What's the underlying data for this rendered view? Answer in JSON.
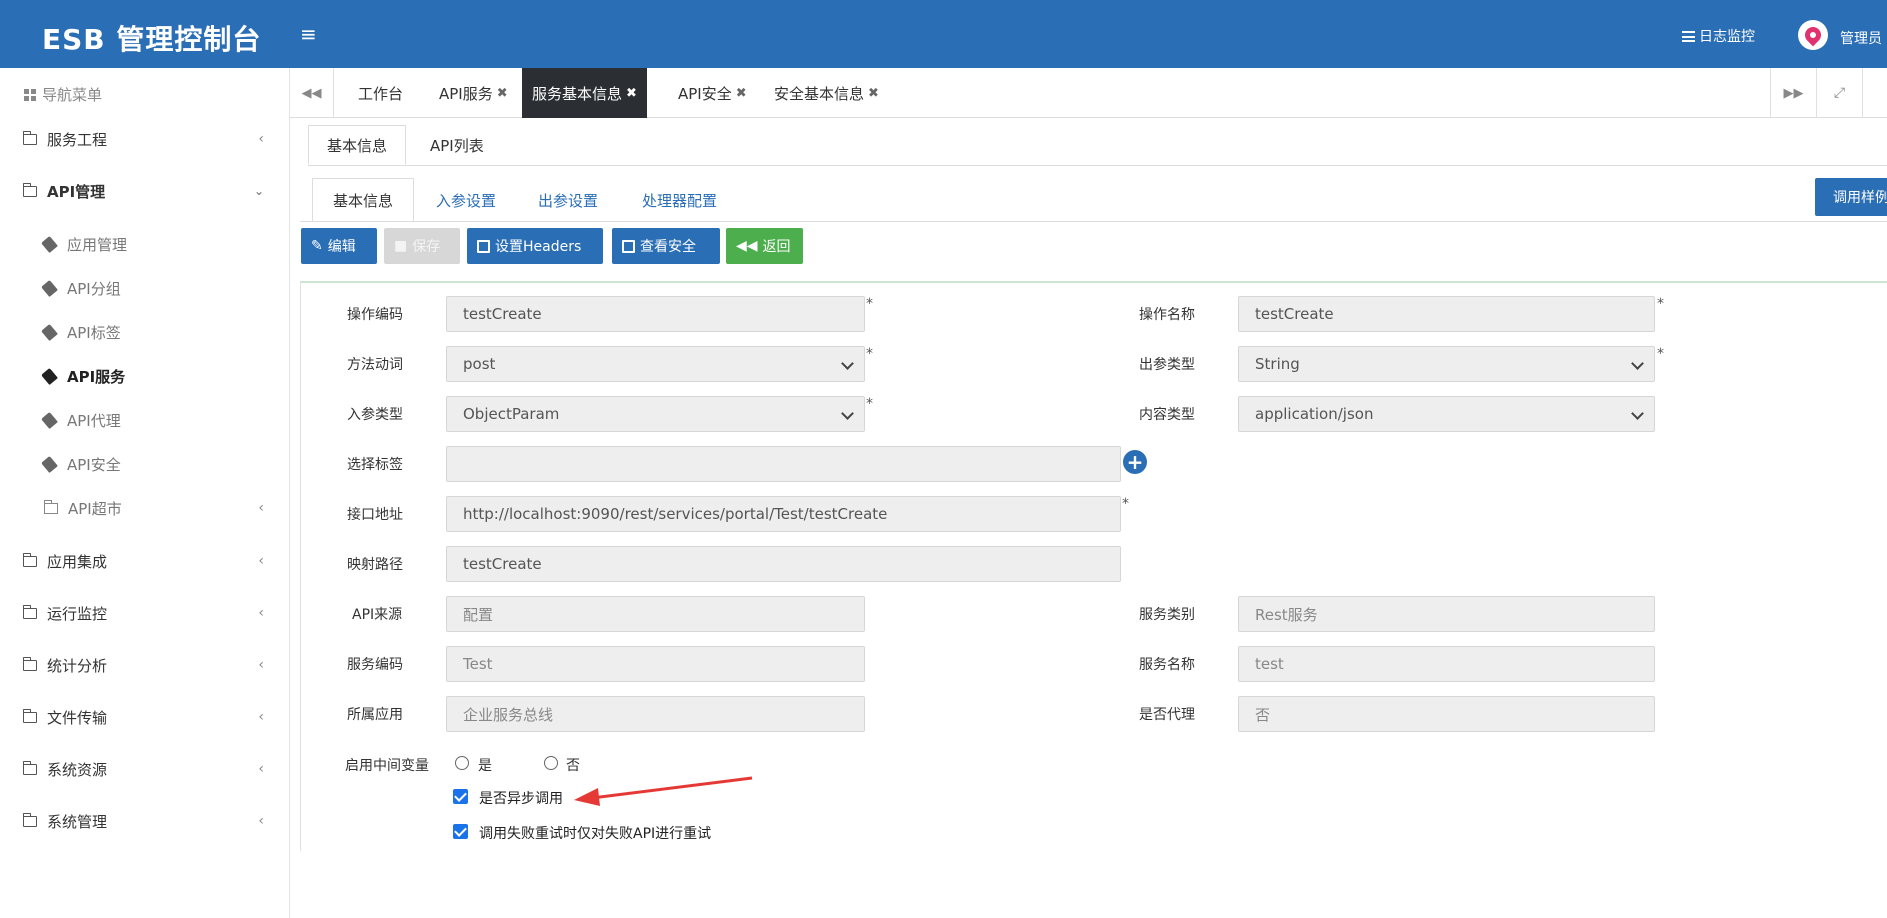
{
  "header": {
    "brand": "ESB 管理控制台",
    "menu_icon": "hamburger-icon",
    "log_monitor": "日志监控",
    "user": "管理员"
  },
  "sidebar": {
    "title": "导航菜单",
    "items": [
      {
        "label": "服务工程"
      },
      {
        "label": "API管理"
      },
      {
        "label": "应用集成"
      },
      {
        "label": "运行监控"
      },
      {
        "label": "统计分析"
      },
      {
        "label": "文件传输"
      },
      {
        "label": "系统资源"
      },
      {
        "label": "系统管理"
      }
    ],
    "api_sub": [
      {
        "label": "应用管理"
      },
      {
        "label": "API分组"
      },
      {
        "label": "API标签"
      },
      {
        "label": "API服务"
      },
      {
        "label": "API代理"
      },
      {
        "label": "API安全"
      },
      {
        "label": "API超市"
      }
    ]
  },
  "tabs": [
    {
      "label": "工作台"
    },
    {
      "label": "API服务"
    },
    {
      "label": "服务基本信息"
    },
    {
      "label": "API安全"
    },
    {
      "label": "安全基本信息"
    }
  ],
  "subtabs": [
    "基本信息",
    "API列表"
  ],
  "inner_tabs": [
    "基本信息",
    "入参设置",
    "出参设置",
    "处理器配置"
  ],
  "sample_button": "调用样例",
  "actions": {
    "edit": "编辑",
    "save": "保存",
    "headers": "设置Headers",
    "security": "查看安全",
    "back": "返回"
  },
  "form": {
    "op_code_label": "操作编码",
    "op_code": "testCreate",
    "op_name_label": "操作名称",
    "op_name": "testCreate",
    "method_label": "方法动词",
    "method": "post",
    "out_type_label": "出参类型",
    "out_type": "String",
    "in_type_label": "入参类型",
    "in_type": "ObjectParam",
    "content_type_label": "内容类型",
    "content_type": "application/json",
    "tags_label": "选择标签",
    "url_label": "接口地址",
    "url": "http://localhost:9090/rest/services/portal/Test/testCreate",
    "map_label": "映射路径",
    "map": "testCreate",
    "source_label": "API来源",
    "source": "配置",
    "svc_type_label": "服务类别",
    "svc_type": "Rest服务",
    "svc_code_label": "服务编码",
    "svc_code": "Test",
    "svc_name_label": "服务名称",
    "svc_name": "test",
    "app_label": "所属应用",
    "app": "企业服务总线",
    "proxy_label": "是否代理",
    "proxy": "否",
    "mid_var_label": "启用中间变量",
    "yes": "是",
    "no": "否",
    "async_label": "是否异步调用",
    "retry_label": "调用失败重试时仅对失败API进行重试",
    "required_mark": "*"
  },
  "colors": {
    "primary": "#2a6eb6",
    "green": "#4cae4c",
    "arrow": "#e53935"
  }
}
